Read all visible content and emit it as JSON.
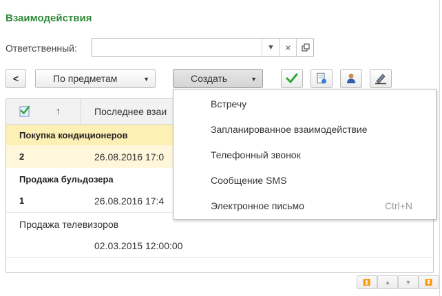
{
  "title": "Взаимодействия",
  "responsible": {
    "label": "Ответственный:",
    "value": "",
    "clear_symbol": "×"
  },
  "toolbar": {
    "back_label": "<",
    "group_by_label": "По предметам",
    "create_label": "Создать"
  },
  "list": {
    "header": {
      "sort_arrow": "↑",
      "col2": "Последнее взаи"
    },
    "rows": [
      {
        "subject": "Покупка кондиционеров",
        "count": "2",
        "date": "26.08.2016 17:0"
      },
      {
        "subject": "Продажа бульдозера",
        "count": "1",
        "date": "26.08.2016 17:4"
      },
      {
        "subject": "Продажа телевизоров",
        "count": "",
        "date": "02.03.2015 12:00:00"
      }
    ]
  },
  "create_menu": {
    "items": [
      {
        "label": "Встречу",
        "shortcut": ""
      },
      {
        "label": "Запланированное взаимодействие",
        "shortcut": ""
      },
      {
        "label": "Телефонный звонок",
        "shortcut": ""
      },
      {
        "label": "Сообщение SMS",
        "shortcut": ""
      },
      {
        "label": "Электронное письмо",
        "shortcut": "Ctrl+N"
      }
    ]
  },
  "colors": {
    "title": "#2f8a3a",
    "highlight_row": "#fdf0b4",
    "highlight_row_light": "#fef7dc"
  },
  "icons": [
    "chevron-left-icon",
    "caret-down-icon",
    "checkmark-icon",
    "document-view-icon",
    "user-icon",
    "pencil-icon",
    "move-first-icon",
    "move-up-icon",
    "move-down-icon",
    "move-last-icon"
  ]
}
